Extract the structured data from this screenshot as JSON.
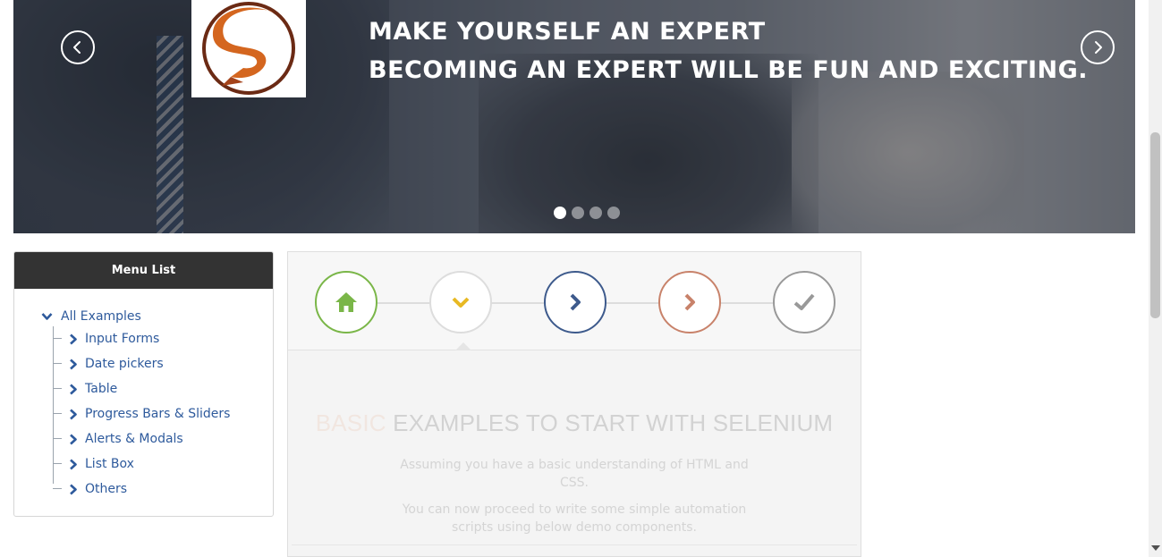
{
  "hero": {
    "line1": "MAKE YOURSELF AN EXPERT",
    "line2": "BECOMING AN EXPERT WILL BE FUN AND EXCITING.",
    "slide_count": 4,
    "active_slide": 1,
    "prev_icon": "chevron-left-icon",
    "next_icon": "chevron-right-icon"
  },
  "logo": {
    "icon": "s-logo",
    "colors": {
      "ring": "#6b2a14",
      "fill": "#d4661f"
    }
  },
  "menu": {
    "title": "Menu List",
    "root": {
      "label": "All Examples",
      "icon": "chevron-down-icon"
    },
    "items": [
      {
        "label": "Input Forms",
        "icon": "chevron-right-icon"
      },
      {
        "label": "Date pickers",
        "icon": "chevron-right-icon"
      },
      {
        "label": "Table",
        "icon": "chevron-right-icon"
      },
      {
        "label": "Progress Bars & Sliders",
        "icon": "chevron-right-icon"
      },
      {
        "label": "Alerts & Modals",
        "icon": "chevron-right-icon"
      },
      {
        "label": "List Box",
        "icon": "chevron-right-icon"
      },
      {
        "label": "Others",
        "icon": "chevron-right-icon"
      }
    ],
    "link_color": "#2e5a9c"
  },
  "wizard": {
    "steps": [
      {
        "icon": "home-icon",
        "color": "#7ab648"
      },
      {
        "icon": "chevron-down-icon",
        "color": "#e8b923"
      },
      {
        "icon": "chevron-right-icon",
        "color": "#3d5a8c"
      },
      {
        "icon": "chevron-right-icon",
        "color": "#c8826a"
      },
      {
        "icon": "check-icon",
        "color": "#999999"
      }
    ],
    "title_highlight": "BASIC",
    "title_rest": "EXAMPLES TO START WITH SELENIUM",
    "paragraph1": "Assuming you have a basic understanding of HTML and CSS.",
    "paragraph2": "You can now proceed to write some simple automation scripts using below demo components."
  }
}
